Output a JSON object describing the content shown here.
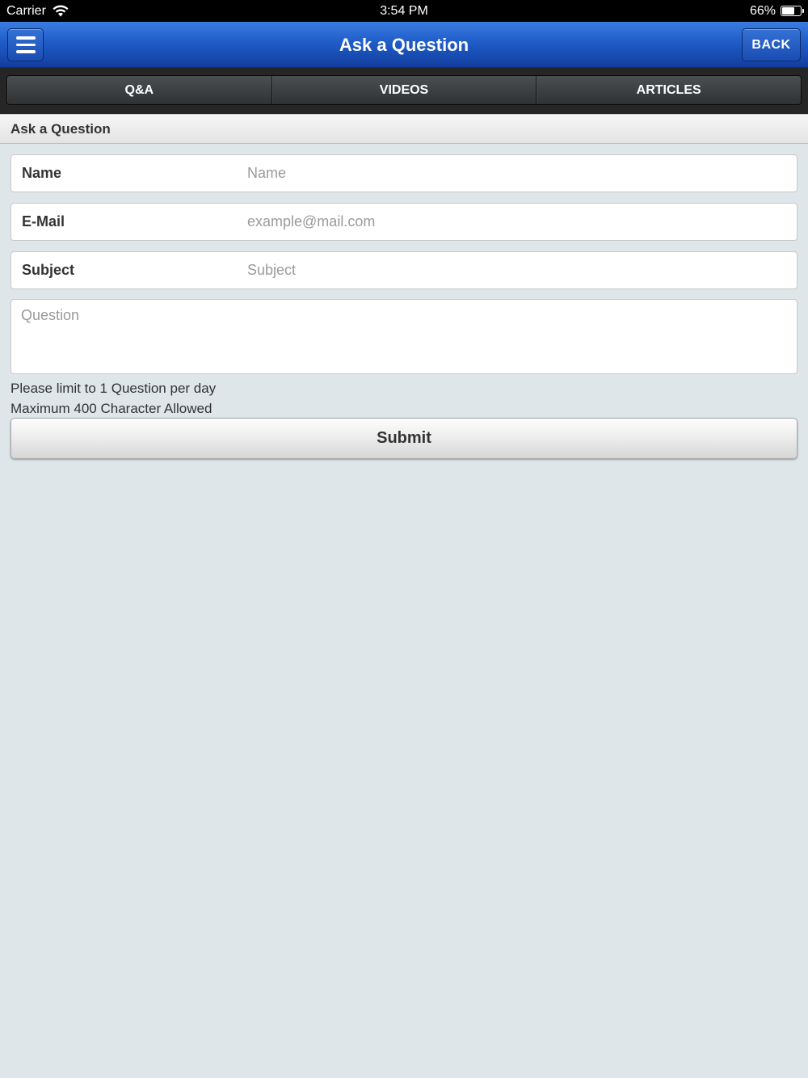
{
  "status_bar": {
    "carrier": "Carrier",
    "time": "3:54 PM",
    "battery_percent": "66%",
    "battery_level": 0.66
  },
  "nav": {
    "title": "Ask a Question",
    "back_label": "BACK",
    "menu_icon": "hamburger-menu-icon"
  },
  "tabs": [
    {
      "label": "Q&A"
    },
    {
      "label": "VIDEOS"
    },
    {
      "label": "ARTICLES"
    }
  ],
  "section": {
    "title": "Ask a Question"
  },
  "form": {
    "name": {
      "label": "Name",
      "placeholder": "Name"
    },
    "email": {
      "label": "E-Mail",
      "placeholder": "example@mail.com"
    },
    "subject": {
      "label": "Subject",
      "placeholder": "Subject"
    },
    "question": {
      "placeholder": "Question"
    },
    "notes": [
      "Please limit to 1 Question per day",
      "Maximum 400 Character Allowed"
    ],
    "submit_label": "Submit"
  },
  "colors": {
    "nav_blue": "#1f5cc8",
    "tab_dark": "#262626",
    "page_bg": "#dfe6ea"
  }
}
